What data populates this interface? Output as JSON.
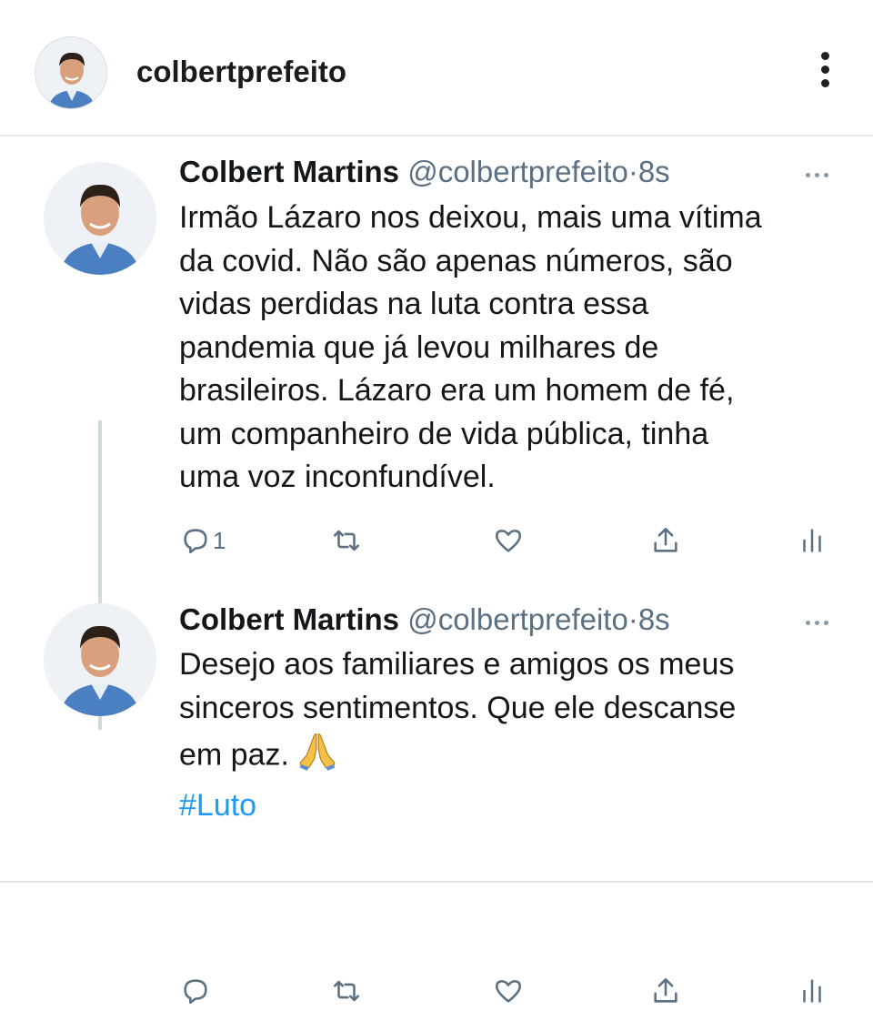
{
  "header": {
    "username": "colbertprefeito",
    "avatar_icon": "profile-photo",
    "more_icon": "vertical-ellipsis-icon"
  },
  "tweets": [
    {
      "name": "Colbert Martins",
      "handle": "@colbertprefeito",
      "sep": "·",
      "time": "8s",
      "lines": [
        "Irmão Lázaro nos deixou, mais uma vítima",
        "da covid. Não são apenas números, são",
        "vidas perdidas na luta contra essa",
        "pandemia que já levou milhares de",
        "brasileiros. Lázaro era um homem de fé,",
        "um companheiro de vida pública, tinha",
        "uma voz inconfundível."
      ],
      "reply_count": "1"
    },
    {
      "name": "Colbert Martins",
      "handle": "@colbertprefeito",
      "sep": "·",
      "time": "8s",
      "lines": [
        "Desejo aos familiares e amigos os meus",
        "sinceros sentimentos. Que ele descanse",
        "em paz."
      ],
      "emoji": "folded-hands-emoji",
      "hashtag": "#Luto",
      "reply_count": ""
    }
  ],
  "colors": {
    "accent": "#1d9bf0",
    "muted": "#5b7083",
    "divider": "#e6e6e6"
  }
}
